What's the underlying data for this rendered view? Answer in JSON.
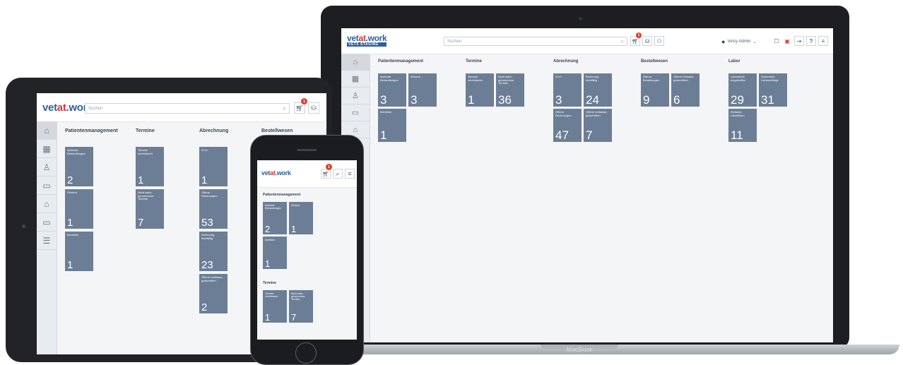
{
  "brand": {
    "logo_prefix": "vet",
    "logo_at": "at",
    "logo_suffix": ".work",
    "logo_sub_laptop": "VETS STAGING",
    "accent": "#2f5f9a",
    "tile_color": "#6b7e96",
    "badge_color": "#d8432f"
  },
  "laptop": {
    "device_label": "MacBook",
    "search_placeholder": "Suchen",
    "cart_badge": "1",
    "user_name": "Vetsy Admin",
    "help_label": "?",
    "nav_icons": [
      "home-icon",
      "calendar-icon",
      "users-icon",
      "folder-icon",
      "house-icon"
    ],
    "columns": [
      {
        "title": "Patientenmanagement",
        "tiles": [
          {
            "label": "laufende Behandlungen",
            "value": "3"
          },
          {
            "label": "Rückruf",
            "value": "3"
          },
          {
            "label": "Merkliste",
            "value": "1"
          }
        ]
      },
      {
        "title": "Termine",
        "tiles": [
          {
            "label": "Termine vereinbaren",
            "value": "1"
          },
          {
            "label": "Nicht wahr-genommene Termine",
            "value": "36"
          }
        ]
      },
      {
        "title": "Abrechnung",
        "tiles": [
          {
            "label": "N.V.L.",
            "value": "3"
          },
          {
            "label": "Rechnung überfällig",
            "value": "24"
          },
          {
            "label": "Offene Rechnungen",
            "value": "47"
          },
          {
            "label": "Offene Vorkasse-gutschriften",
            "value": "7"
          }
        ]
      },
      {
        "title": "Bestellwesen",
        "tiles": [
          {
            "label": "Offene Bestellungen",
            "value": "9"
          },
          {
            "label": "Offene Einkaufs-gutschriften",
            "value": "6"
          }
        ]
      },
      {
        "title": "Labor",
        "tiles": [
          {
            "label": "Laborwerte eingetroffen",
            "value": "29"
          },
          {
            "label": "Gesendete Laboraufträge",
            "value": "31"
          },
          {
            "label": "Einfache Laborlisten",
            "value": "11"
          }
        ]
      }
    ]
  },
  "tablet": {
    "search_placeholder": "Suchen",
    "cart_badge": "1",
    "nav_icons": [
      "home-icon",
      "calendar-icon",
      "users-icon",
      "folder-icon",
      "house-icon",
      "folder-icon",
      "list-icon"
    ],
    "columns": [
      {
        "title": "Patientenmanagement",
        "tiles": [
          {
            "label": "laufende Behandlungen",
            "value": "2"
          },
          {
            "label": "Rückruf",
            "value": "1"
          },
          {
            "label": "Merkliste",
            "value": "1"
          }
        ]
      },
      {
        "title": "Termine",
        "tiles": [
          {
            "label": "Termine vereinbaren",
            "value": "1"
          },
          {
            "label": "Nicht wahr-genommene Termine",
            "value": "7"
          }
        ]
      },
      {
        "title": "Abrechnung",
        "tiles": [
          {
            "label": "N.V.L.",
            "value": "1"
          },
          {
            "label": "Offene Rechnungen",
            "value": "53"
          },
          {
            "label": "Rechnung überfällig",
            "value": "23"
          },
          {
            "label": "Offene Vorkasse-gutschriften",
            "value": "2"
          }
        ]
      },
      {
        "title": "Bestellwesen",
        "tiles": []
      }
    ]
  },
  "phone": {
    "cart_badge": "1",
    "sections": [
      {
        "title": "Patientenmanagement",
        "tiles": [
          {
            "label": "laufende Behandlungen",
            "value": "2"
          },
          {
            "label": "Rückruf",
            "value": "1"
          },
          {
            "label": "Merkliste",
            "value": "1"
          }
        ]
      },
      {
        "title": "Termine",
        "tiles": [
          {
            "label": "Termine vereinbaren",
            "value": "1"
          },
          {
            "label": "Nicht wahr-genommene Termine",
            "value": "7"
          }
        ]
      }
    ]
  }
}
